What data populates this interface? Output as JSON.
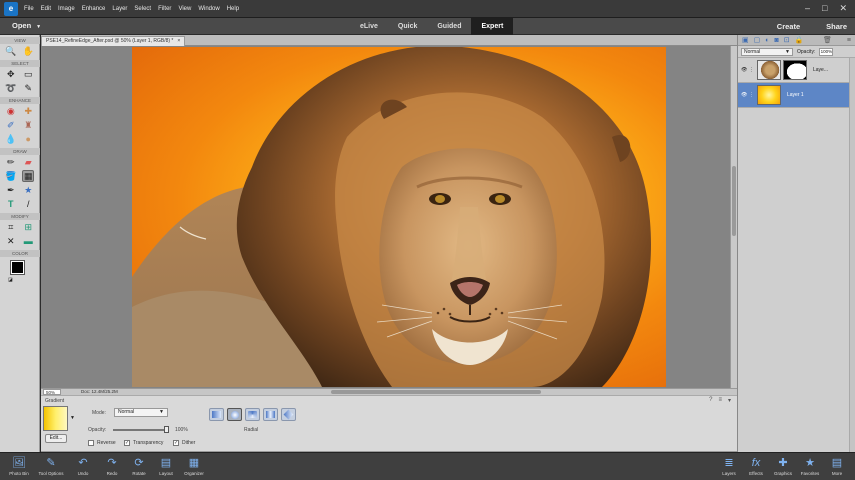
{
  "menu": [
    "File",
    "Edit",
    "Image",
    "Enhance",
    "Layer",
    "Select",
    "Filter",
    "View",
    "Window",
    "Help"
  ],
  "window_controls": [
    "–",
    "□",
    "✕"
  ],
  "mode_bar": {
    "open_label": "Open",
    "tabs": [
      "eLive",
      "Quick",
      "Guided",
      "Expert"
    ],
    "active_tab": "Expert",
    "create_label": "Create",
    "share_label": "Share"
  },
  "toolbox": {
    "sections": [
      "VIEW",
      "SELECT",
      "ENHANCE",
      "DRAW",
      "MODIFY",
      "COLOR"
    ],
    "icons": {
      "view": [
        "zoom-icon",
        "hand-icon"
      ],
      "select": [
        "move-icon",
        "marquee-icon",
        "lasso-icon",
        "quick-selection-icon"
      ],
      "enhance": [
        "red-eye-icon",
        "spot-healing-icon",
        "smart-brush-icon",
        "clone-stamp-icon",
        "blur-icon",
        "sponge-icon"
      ],
      "draw": [
        "brush-icon",
        "eraser-icon",
        "paint-bucket-icon",
        "gradient-icon",
        "eyedropper-icon",
        "custom-shape-icon",
        "type-icon",
        "pencil-icon"
      ],
      "modify": [
        "crop-icon",
        "recompose-icon",
        "content-move-icon",
        "straighten-icon"
      ]
    }
  },
  "document": {
    "tab_title": "PSE14_RefineEdge_After.psd @ 50% (Layer 1, RGB/8) *",
    "zoom": "50%",
    "doc_size": "Doc: 12.4M/25.2M"
  },
  "tool_options": {
    "tool_name": "Gradient",
    "edit_label": "Edit...",
    "mode_label": "Mode:",
    "mode_value": "Normal",
    "opacity_label": "Opacity:",
    "opacity_value": "100%",
    "opacity_fraction": 1.0,
    "checkboxes": [
      {
        "label": "Reverse",
        "checked": false
      },
      {
        "label": "Transparency",
        "checked": true
      },
      {
        "label": "Dither",
        "checked": true
      }
    ],
    "gradient_types": [
      "Linear",
      "Radial",
      "Angle",
      "Reflected",
      "Diamond"
    ],
    "selected_type": "Radial",
    "selected_type_label": "Radial"
  },
  "layers_panel": {
    "blend_mode": "Normal",
    "opacity_label": "Opacity:",
    "opacity_value": "100%",
    "layers": [
      {
        "name": "Laye...",
        "selected": false
      },
      {
        "name": "Layer 1",
        "selected": true
      }
    ]
  },
  "taskbar": {
    "left": [
      "Photo Bin",
      "Tool Options",
      "Undo",
      "Redo",
      "Rotate",
      "Layout",
      "Organizer"
    ],
    "right": [
      "Layers",
      "Effects",
      "Graphics",
      "Favorites",
      "More"
    ]
  },
  "colors": {
    "accent": "#1a74c5",
    "selected_layer": "#5d86c6",
    "background_gradient_center": "#ffd94a",
    "background_gradient_edge": "#e0620a"
  }
}
